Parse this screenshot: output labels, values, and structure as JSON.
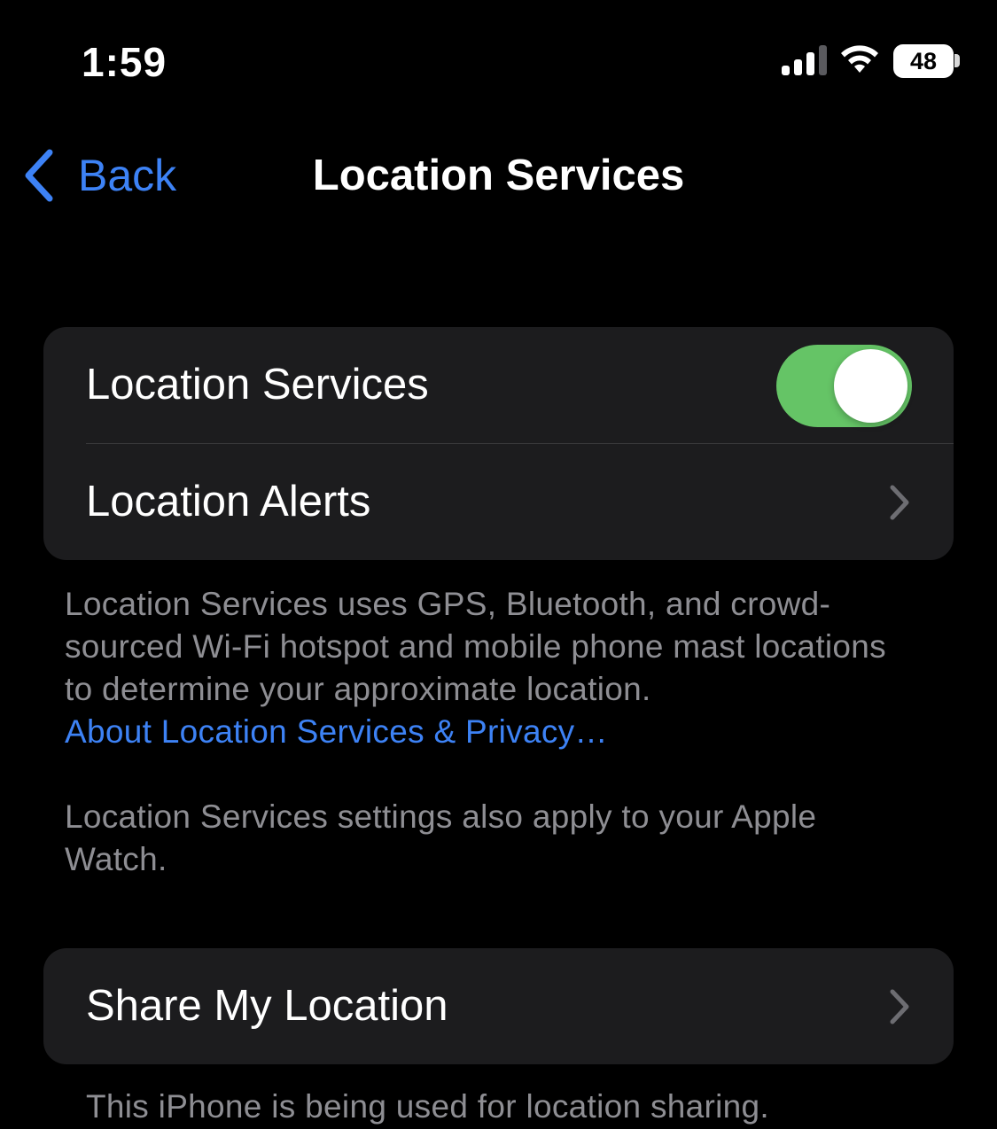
{
  "status_bar": {
    "time": "1:59",
    "battery_level": "48",
    "signal_icon": "cellular-signal-icon",
    "wifi_icon": "wifi-icon"
  },
  "nav": {
    "back_label": "Back",
    "title": "Location Services"
  },
  "group1": {
    "location_services_label": "Location Services",
    "location_services_enabled": true,
    "location_alerts_label": "Location Alerts"
  },
  "footnote1": {
    "text": "Location Services uses GPS, Bluetooth, and crowd-sourced Wi-Fi hotspot and mobile phone mast locations to determine your approximate location.",
    "link": "About Location Services & Privacy…"
  },
  "footnote2": {
    "text": "Location Services settings also apply to your Apple Watch."
  },
  "group2": {
    "share_my_location_label": "Share My Location"
  },
  "footnote3": {
    "text": "This iPhone is being used for location sharing."
  },
  "colors": {
    "background": "#000000",
    "cell": "#1c1c1e",
    "accent": "#3d82f5",
    "toggle_on": "#65c466",
    "secondary_text": "#8e8e93"
  }
}
